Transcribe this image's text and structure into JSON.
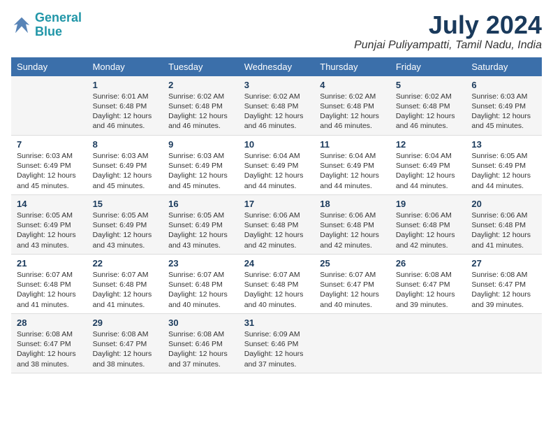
{
  "logo": {
    "line1": "General",
    "line2": "Blue"
  },
  "title": "July 2024",
  "location": "Punjai Puliyampatti, Tamil Nadu, India",
  "days_header": [
    "Sunday",
    "Monday",
    "Tuesday",
    "Wednesday",
    "Thursday",
    "Friday",
    "Saturday"
  ],
  "weeks": [
    [
      {
        "day": "",
        "info": ""
      },
      {
        "day": "1",
        "info": "Sunrise: 6:01 AM\nSunset: 6:48 PM\nDaylight: 12 hours\nand 46 minutes."
      },
      {
        "day": "2",
        "info": "Sunrise: 6:02 AM\nSunset: 6:48 PM\nDaylight: 12 hours\nand 46 minutes."
      },
      {
        "day": "3",
        "info": "Sunrise: 6:02 AM\nSunset: 6:48 PM\nDaylight: 12 hours\nand 46 minutes."
      },
      {
        "day": "4",
        "info": "Sunrise: 6:02 AM\nSunset: 6:48 PM\nDaylight: 12 hours\nand 46 minutes."
      },
      {
        "day": "5",
        "info": "Sunrise: 6:02 AM\nSunset: 6:48 PM\nDaylight: 12 hours\nand 46 minutes."
      },
      {
        "day": "6",
        "info": "Sunrise: 6:03 AM\nSunset: 6:49 PM\nDaylight: 12 hours\nand 45 minutes."
      }
    ],
    [
      {
        "day": "7",
        "info": "Sunrise: 6:03 AM\nSunset: 6:49 PM\nDaylight: 12 hours\nand 45 minutes."
      },
      {
        "day": "8",
        "info": "Sunrise: 6:03 AM\nSunset: 6:49 PM\nDaylight: 12 hours\nand 45 minutes."
      },
      {
        "day": "9",
        "info": "Sunrise: 6:03 AM\nSunset: 6:49 PM\nDaylight: 12 hours\nand 45 minutes."
      },
      {
        "day": "10",
        "info": "Sunrise: 6:04 AM\nSunset: 6:49 PM\nDaylight: 12 hours\nand 44 minutes."
      },
      {
        "day": "11",
        "info": "Sunrise: 6:04 AM\nSunset: 6:49 PM\nDaylight: 12 hours\nand 44 minutes."
      },
      {
        "day": "12",
        "info": "Sunrise: 6:04 AM\nSunset: 6:49 PM\nDaylight: 12 hours\nand 44 minutes."
      },
      {
        "day": "13",
        "info": "Sunrise: 6:05 AM\nSunset: 6:49 PM\nDaylight: 12 hours\nand 44 minutes."
      }
    ],
    [
      {
        "day": "14",
        "info": "Sunrise: 6:05 AM\nSunset: 6:49 PM\nDaylight: 12 hours\nand 43 minutes."
      },
      {
        "day": "15",
        "info": "Sunrise: 6:05 AM\nSunset: 6:49 PM\nDaylight: 12 hours\nand 43 minutes."
      },
      {
        "day": "16",
        "info": "Sunrise: 6:05 AM\nSunset: 6:49 PM\nDaylight: 12 hours\nand 43 minutes."
      },
      {
        "day": "17",
        "info": "Sunrise: 6:06 AM\nSunset: 6:48 PM\nDaylight: 12 hours\nand 42 minutes."
      },
      {
        "day": "18",
        "info": "Sunrise: 6:06 AM\nSunset: 6:48 PM\nDaylight: 12 hours\nand 42 minutes."
      },
      {
        "day": "19",
        "info": "Sunrise: 6:06 AM\nSunset: 6:48 PM\nDaylight: 12 hours\nand 42 minutes."
      },
      {
        "day": "20",
        "info": "Sunrise: 6:06 AM\nSunset: 6:48 PM\nDaylight: 12 hours\nand 41 minutes."
      }
    ],
    [
      {
        "day": "21",
        "info": "Sunrise: 6:07 AM\nSunset: 6:48 PM\nDaylight: 12 hours\nand 41 minutes."
      },
      {
        "day": "22",
        "info": "Sunrise: 6:07 AM\nSunset: 6:48 PM\nDaylight: 12 hours\nand 41 minutes."
      },
      {
        "day": "23",
        "info": "Sunrise: 6:07 AM\nSunset: 6:48 PM\nDaylight: 12 hours\nand 40 minutes."
      },
      {
        "day": "24",
        "info": "Sunrise: 6:07 AM\nSunset: 6:48 PM\nDaylight: 12 hours\nand 40 minutes."
      },
      {
        "day": "25",
        "info": "Sunrise: 6:07 AM\nSunset: 6:47 PM\nDaylight: 12 hours\nand 40 minutes."
      },
      {
        "day": "26",
        "info": "Sunrise: 6:08 AM\nSunset: 6:47 PM\nDaylight: 12 hours\nand 39 minutes."
      },
      {
        "day": "27",
        "info": "Sunrise: 6:08 AM\nSunset: 6:47 PM\nDaylight: 12 hours\nand 39 minutes."
      }
    ],
    [
      {
        "day": "28",
        "info": "Sunrise: 6:08 AM\nSunset: 6:47 PM\nDaylight: 12 hours\nand 38 minutes."
      },
      {
        "day": "29",
        "info": "Sunrise: 6:08 AM\nSunset: 6:47 PM\nDaylight: 12 hours\nand 38 minutes."
      },
      {
        "day": "30",
        "info": "Sunrise: 6:08 AM\nSunset: 6:46 PM\nDaylight: 12 hours\nand 37 minutes."
      },
      {
        "day": "31",
        "info": "Sunrise: 6:09 AM\nSunset: 6:46 PM\nDaylight: 12 hours\nand 37 minutes."
      },
      {
        "day": "",
        "info": ""
      },
      {
        "day": "",
        "info": ""
      },
      {
        "day": "",
        "info": ""
      }
    ]
  ]
}
